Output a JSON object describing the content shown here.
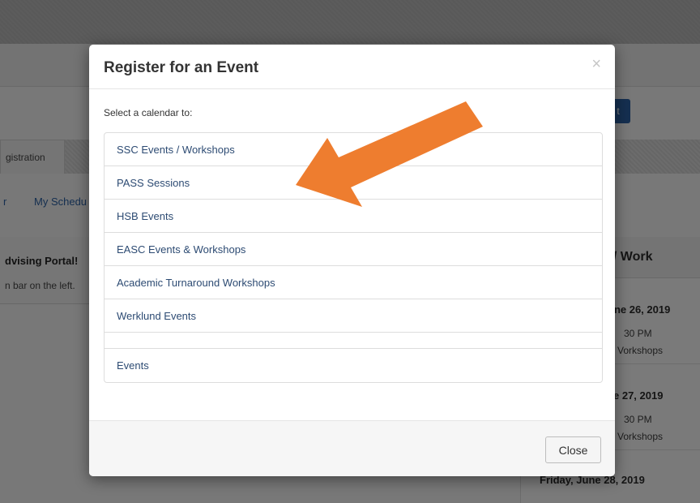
{
  "background": {
    "tab_active_label": "gistration",
    "subnav_left": "r",
    "subnav_right": "My Schedu",
    "button_glyph": "t",
    "welcome_title": "dvising Portal!",
    "welcome_text": "n bar on the left.",
    "right_panel": {
      "title": "Events / Work",
      "days": [
        {
          "day": "une 26, 2019",
          "time": "30 PM",
          "label": "Vorkshops"
        },
        {
          "day": "e 27, 2019",
          "time": "30 PM",
          "label": "Vorkshops"
        },
        {
          "day": "Friday, June 28, 2019",
          "time": "",
          "label": ""
        }
      ]
    }
  },
  "modal": {
    "title": "Register for an Event",
    "close_symbol": "×",
    "intro": "Select a calendar to:",
    "items": [
      "SSC Events / Workshops",
      "PASS Sessions",
      "HSB Events",
      "EASC Events & Workshops",
      "Academic Turnaround Workshops",
      "Werklund Events",
      "",
      "Events"
    ],
    "close_button": "Close"
  },
  "annotation": {
    "arrow_color": "#ee7d2f"
  }
}
